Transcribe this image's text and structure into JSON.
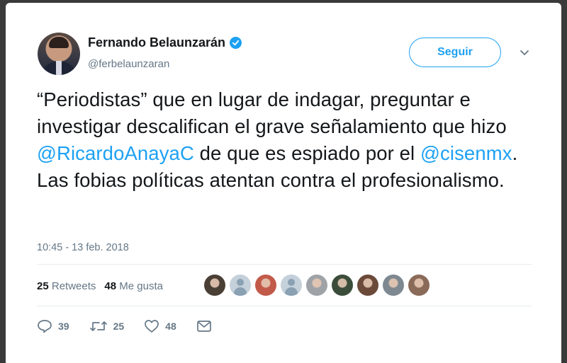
{
  "author": {
    "name": "Fernando Belaunzarán",
    "handle": "@ferbelaunzaran",
    "verified": true
  },
  "follow_button_label": "Seguir",
  "tweet": {
    "parts": [
      {
        "text": "“Periodistas” que en lugar de indagar, preguntar e investigar descalifican el grave señalamiento que hizo ",
        "mention": false
      },
      {
        "text": "@RicardoAnayaC",
        "mention": true
      },
      {
        "text": " de que es espiado por el ",
        "mention": false
      },
      {
        "text": "@cisenmx",
        "mention": true
      },
      {
        "text": ". Las fobias políticas atentan contra el profesionalismo.",
        "mention": false
      }
    ]
  },
  "timestamp": "10:45 - 13 feb. 2018",
  "stats": {
    "retweets_count": "25",
    "retweets_label": "Retweets",
    "likes_count": "48",
    "likes_label": "Me gusta"
  },
  "likers": [
    {
      "type": "photo",
      "color": "#4a3f35"
    },
    {
      "type": "default"
    },
    {
      "type": "photo",
      "color": "#c25a4a"
    },
    {
      "type": "default"
    },
    {
      "type": "photo",
      "color": "#9fa3a8"
    },
    {
      "type": "photo",
      "color": "#3b4d3a"
    },
    {
      "type": "photo",
      "color": "#6b4a3a"
    },
    {
      "type": "photo",
      "color": "#7d8890"
    },
    {
      "type": "photo",
      "color": "#8a6a58"
    }
  ],
  "actions": {
    "reply_count": "39",
    "retweet_count": "25",
    "like_count": "48"
  },
  "colors": {
    "accent": "#1da1f2",
    "text": "#14171a",
    "secondary": "#657786"
  }
}
